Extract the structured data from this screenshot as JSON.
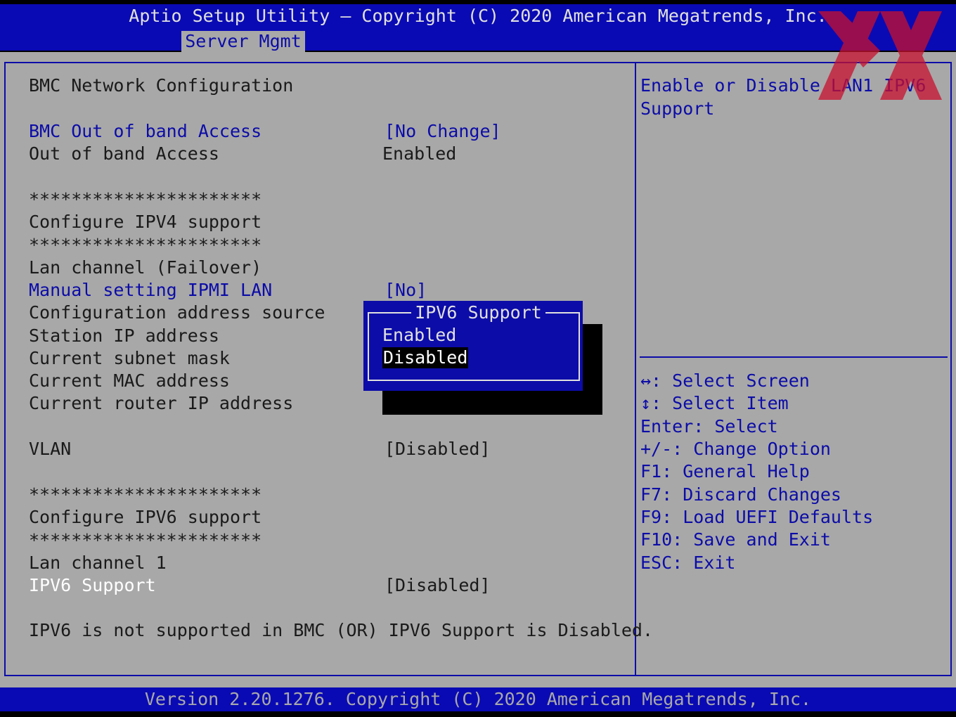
{
  "header": {
    "title": "Aptio Setup Utility – Copyright (C) 2020 American Megatrends, Inc.",
    "active_tab": "Server Mgmt"
  },
  "main": {
    "section_title": "BMC Network Configuration",
    "items": {
      "bmc_oob_label": "BMC Out of band Access",
      "bmc_oob_value": "[No Change]",
      "oob_label": "Out of band Access",
      "oob_value": "Enabled",
      "stars1": "**********************",
      "ipv4_heading": "Configure IPV4 support",
      "stars2": "**********************",
      "lan_failover": "Lan channel (Failover)",
      "manual_ipmi_label": "Manual setting IPMI LAN",
      "manual_ipmi_value": "[No]",
      "config_addr_source": "Configuration address source",
      "station_ip": "Station IP address",
      "subnet_mask": "Current subnet mask",
      "mac_address": "Current MAC address",
      "router_ip": "Current router IP address",
      "vlan_label": "VLAN",
      "vlan_value": "[Disabled]",
      "stars3": "**********************",
      "ipv6_heading": "Configure IPV6 support",
      "stars4": "**********************",
      "lan_channel1": "Lan channel 1",
      "ipv6_support_label": "IPV6 Support",
      "ipv6_support_value": "[Disabled]",
      "ipv6_note": "IPV6 is not supported in BMC (OR) IPV6 Support is Disabled."
    }
  },
  "popup": {
    "title": "IPV6 Support",
    "options": [
      "Enabled",
      "Disabled"
    ],
    "selected": "Disabled"
  },
  "help": {
    "description_line1": "Enable or Disable LAN1 IPV6",
    "description_line2": "Support",
    "keys": [
      "↔: Select Screen",
      "↕: Select Item",
      "Enter: Select",
      "+/-: Change Option",
      "F1: General Help",
      "F7: Discard Changes",
      "F9: Load UEFI Defaults",
      "F10: Save and Exit",
      "ESC: Exit"
    ]
  },
  "footer": {
    "version": "Version 2.20.1276. Copyright (C) 2020 American Megatrends, Inc."
  },
  "colors": {
    "bar_blue": "#0a0ab4",
    "panel_gray": "#a8a8a8",
    "text_blue": "#0c0ca8",
    "watermark_red": "#c8102e"
  }
}
